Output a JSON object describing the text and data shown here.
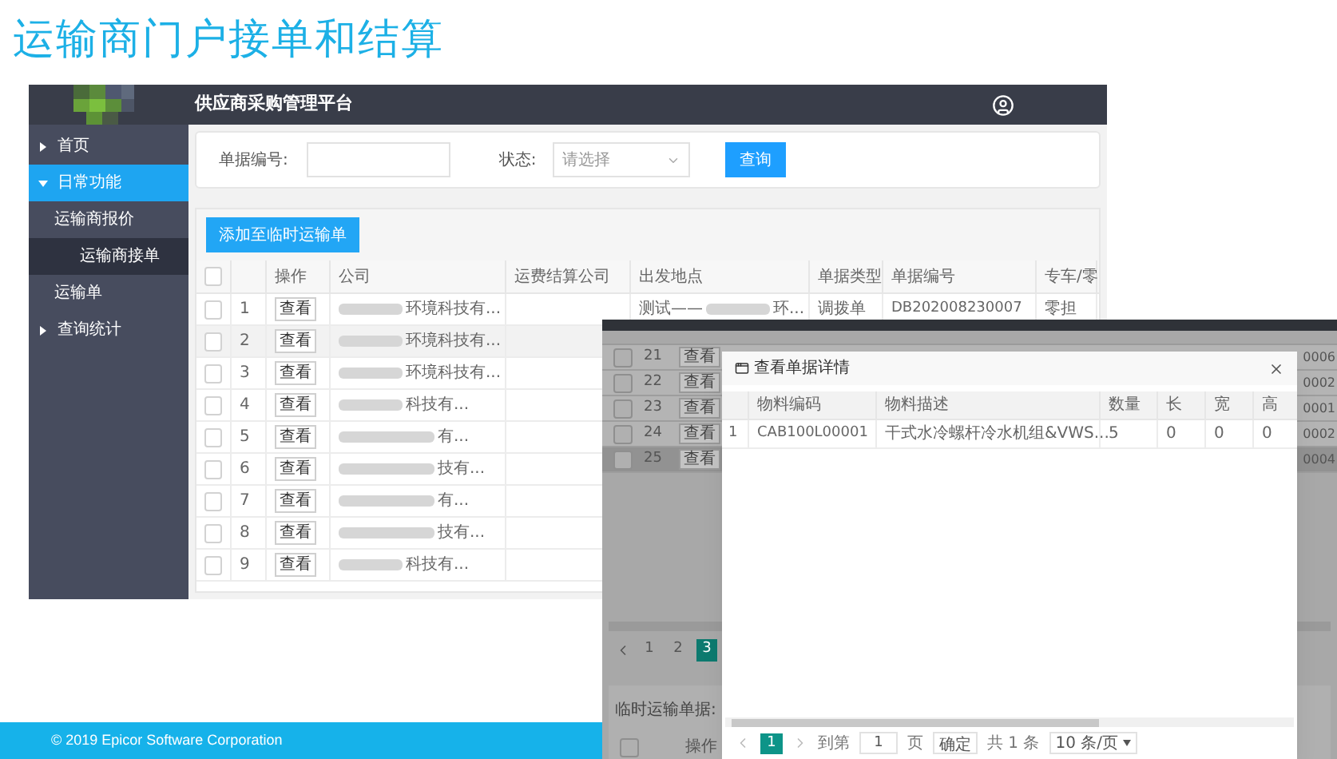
{
  "slide": {
    "title": "运输商门户接单和结算",
    "footer": "© 2019 Epicor Software Corporation"
  },
  "main_screenshot": {
    "header_title": "供应商采购管理平台",
    "sidebar": [
      {
        "label": "首页",
        "kind": "group",
        "expanded": false,
        "selected": false
      },
      {
        "label": "日常功能",
        "kind": "group",
        "expanded": true,
        "selected": true,
        "children": [
          {
            "label": "运输商报价",
            "selected": false,
            "children": [
              {
                "label": "运输商接单",
                "selected": true
              }
            ]
          },
          {
            "label": "运输单",
            "selected": false
          }
        ]
      },
      {
        "label": "查询统计",
        "kind": "group",
        "expanded": false,
        "selected": false
      }
    ],
    "search": {
      "fields": [
        {
          "label": "单据编号:",
          "kind": "input"
        },
        {
          "label": "状态:",
          "kind": "select",
          "placeholder": "请选择"
        }
      ],
      "button": "查询"
    },
    "add_button": "添加至临时运输单",
    "table": {
      "columns": [
        {
          "kind": "checkbox",
          "checked": false
        },
        {
          "kind": "index"
        },
        {
          "kind": "text",
          "label": "操作"
        },
        {
          "kind": "text",
          "label": "公司"
        },
        {
          "kind": "text",
          "label": "运费结算公司"
        },
        {
          "kind": "text",
          "label": "出发地点"
        },
        {
          "kind": "text",
          "label": "单据类型"
        },
        {
          "kind": "text",
          "label": "单据编号"
        },
        {
          "kind": "text",
          "label": "专车/零"
        }
      ],
      "rows": [
        {
          "index": "1",
          "action": "查看",
          "company": "环境科技有...",
          "departure": [
            "测试——",
            "环..."
          ],
          "doc_type": "调拨单",
          "doc_no": "DB202008230007",
          "load_type": "零担",
          "highlighted": false
        },
        {
          "index": "2",
          "action": "查看",
          "company": "环境科技有...",
          "highlighted": true
        },
        {
          "index": "3",
          "action": "查看",
          "company": "环境科技有...",
          "highlighted": false
        },
        {
          "index": "4",
          "action": "查看",
          "company": "科技有...",
          "highlighted": false
        },
        {
          "index": "5",
          "action": "查看",
          "company": "有...",
          "highlighted": false
        },
        {
          "index": "6",
          "action": "查看",
          "company": "技有...",
          "highlighted": false
        },
        {
          "index": "7",
          "action": "查看",
          "company": "有...",
          "highlighted": false
        },
        {
          "index": "8",
          "action": "查看",
          "company": "技有...",
          "highlighted": false
        },
        {
          "index": "9",
          "action": "查看",
          "company": "科技有...",
          "highlighted": false
        }
      ]
    }
  },
  "second_screenshot": {
    "rows": [
      {
        "index": "21",
        "action": "查看",
        "doc_no_tail": "0006",
        "highlighted": false
      },
      {
        "index": "22",
        "action": "查看",
        "doc_no_tail": "0002",
        "highlighted": false
      },
      {
        "index": "23",
        "action": "查看",
        "doc_no_tail": "0001",
        "highlighted": false
      },
      {
        "index": "24",
        "action": "查看",
        "doc_no_tail": "0002",
        "highlighted": false
      },
      {
        "index": "25",
        "action": "查看",
        "doc_no_tail": "0004",
        "highlighted": true
      }
    ],
    "pagination": [
      {
        "label": "1",
        "selected": false
      },
      {
        "label": "2",
        "selected": false
      },
      {
        "label": "3",
        "selected": true
      }
    ],
    "temp_label": "临时运输单据:",
    "temp_checked": false,
    "temp_column": "操作",
    "modal": {
      "title": "查看单据详情",
      "columns": [
        "物料编码",
        "物料描述",
        "数量",
        "长",
        "宽",
        "高"
      ],
      "rows": [
        {
          "index": "1",
          "cells": [
            "CAB100L00001",
            "干式水冷螺杆冷水机组&VWS...",
            "5",
            "0",
            "0",
            "0"
          ]
        }
      ],
      "pagination": {
        "pages": [
          {
            "label": "1",
            "selected": true
          }
        ],
        "goto_label": "到第",
        "goto_value": "1",
        "page_unit": "页",
        "confirm": "确定",
        "total": "共 1 条",
        "page_size": "10 条/页"
      }
    }
  }
}
